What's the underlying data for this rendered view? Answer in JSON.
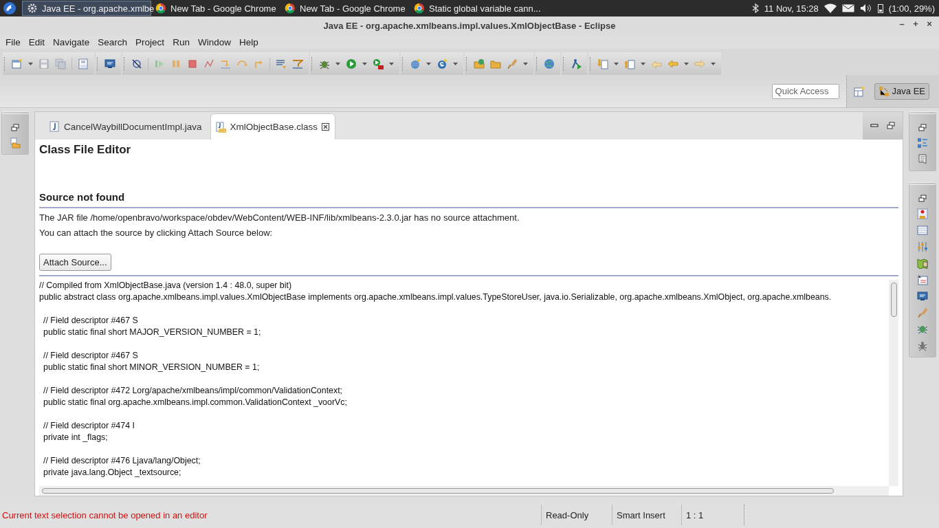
{
  "taskbar": {
    "tasks": [
      {
        "label": "Java EE - org.apache.xmlbe",
        "kind": "eclipse",
        "selected": true
      },
      {
        "label": "New Tab - Google Chrome",
        "kind": "browser",
        "selected": false
      },
      {
        "label": "New Tab - Google Chrome",
        "kind": "browser",
        "selected": false
      },
      {
        "label": "Static global variable cann...",
        "kind": "browser",
        "selected": false
      }
    ],
    "clock": "11 Nov, 15:28",
    "battery": "(1:00, 29%)"
  },
  "window": {
    "title": "Java EE - org.apache.xmlbeans.impl.values.XmlObjectBase - Eclipse",
    "controls": [
      "–",
      "+",
      "×"
    ]
  },
  "menu": [
    "File",
    "Edit",
    "Navigate",
    "Search",
    "Project",
    "Run",
    "Window",
    "Help"
  ],
  "toolbar": {
    "quick_access": {
      "placeholder": "Quick Access"
    },
    "perspective": {
      "label": "Java EE",
      "selected": true
    }
  },
  "editor": {
    "tabs": [
      {
        "label": "CancelWaybillDocumentImpl.java",
        "kind": "java",
        "selected": false
      },
      {
        "label": "XmlObjectBase.class",
        "kind": "class",
        "selected": true
      }
    ],
    "heading": "Class File Editor",
    "section_title": "Source not found",
    "messages": [
      "The JAR file /home/openbravo/workspace/obdev/WebContent/WEB-INF/lib/xmlbeans-2.3.0.jar has no source attachment.",
      "You can attach the source by clicking Attach Source below:"
    ],
    "button": "Attach Source...",
    "code_blocks": [
      [
        "// Compiled from XmlObjectBase.java (version 1.4 : 48.0, super bit)",
        "public abstract class org.apache.xmlbeans.impl.values.XmlObjectBase implements org.apache.xmlbeans.impl.values.TypeStoreUser, java.io.Serializable, org.apache.xmlbeans.XmlObject, org.apache.xmlbeans."
      ],
      [
        "// Field descriptor #467 S",
        "public static final short MAJOR_VERSION_NUMBER = 1;"
      ],
      [
        "// Field descriptor #467 S",
        "public static final short MINOR_VERSION_NUMBER = 1;"
      ],
      [
        "// Field descriptor #472 Lorg/apache/xmlbeans/impl/common/ValidationContext;",
        "public static final org.apache.xmlbeans.impl.common.ValidationContext _voorVc;"
      ],
      [
        "// Field descriptor #474 I",
        "private int _flags;"
      ],
      [
        "// Field descriptor #476 Ljava/lang/Object;",
        "private java.lang.Object _textsource;"
      ]
    ]
  },
  "status_bar": {
    "message": "Current text selection cannot be opened in an editor",
    "fields": [
      "Read-Only",
      "Smart Insert",
      "1 : 1"
    ]
  }
}
